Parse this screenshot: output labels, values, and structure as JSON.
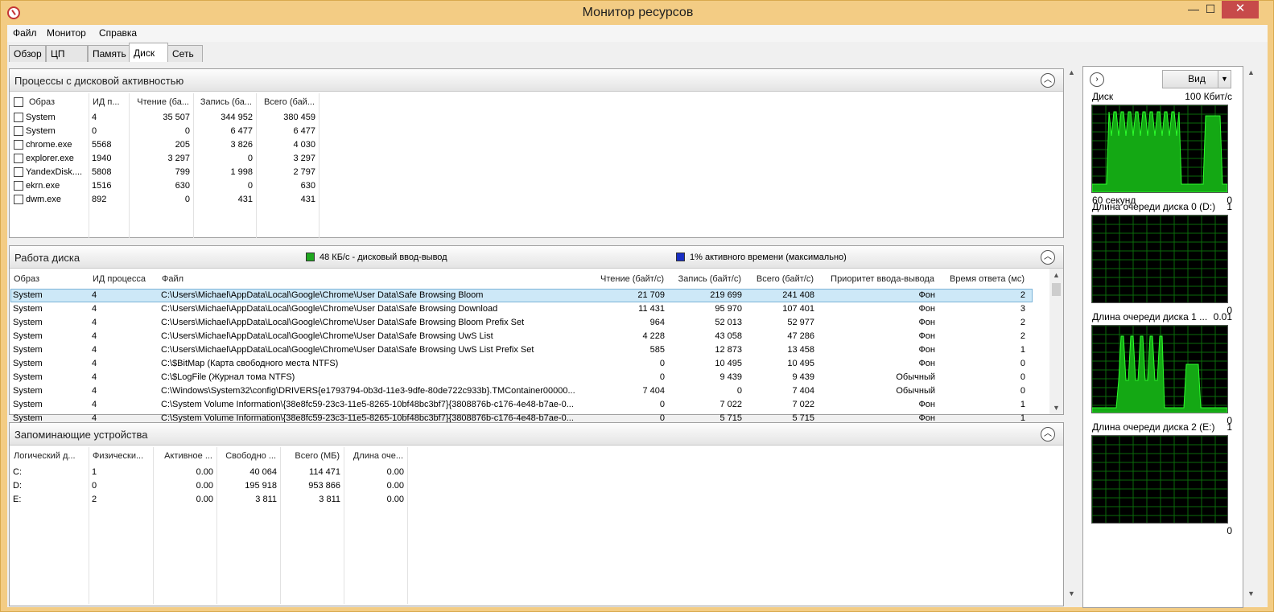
{
  "window": {
    "title": "Монитор ресурсов",
    "minimize": "—",
    "maximize": "☐",
    "close": "✕"
  },
  "menu": [
    "Файл",
    "Монитор",
    "Справка"
  ],
  "tabs": [
    "Обзор",
    "ЦП",
    "Память",
    "Диск",
    "Сеть"
  ],
  "active_tab": "Диск",
  "processes": {
    "title": "Процессы с дисковой активностью",
    "columns": [
      "Образ",
      "ИД п...",
      "Чтение (ба...",
      "Запись (ба...",
      "Всего (бай..."
    ],
    "rows": [
      [
        "System",
        "4",
        "35 507",
        "344 952",
        "380 459"
      ],
      [
        "System",
        "0",
        "0",
        "6 477",
        "6 477"
      ],
      [
        "chrome.exe",
        "5568",
        "205",
        "3 826",
        "4 030"
      ],
      [
        "explorer.exe",
        "1940",
        "3 297",
        "0",
        "3 297"
      ],
      [
        "YandexDisk....",
        "5808",
        "799",
        "1 998",
        "2 797"
      ],
      [
        "ekrn.exe",
        "1516",
        "630",
        "0",
        "630"
      ],
      [
        "dwm.exe",
        "892",
        "0",
        "431",
        "431"
      ]
    ]
  },
  "disk_activity": {
    "title": "Работа диска",
    "legend_io": "48 КБ/с - дисковый ввод-вывод",
    "legend_active": "1% активного времени (максимально)",
    "legend_io_color": "#1fa81f",
    "legend_active_color": "#1a2fc4",
    "columns": [
      "Образ",
      "ИД процесса",
      "Файл",
      "Чтение (байт/с)",
      "Запись (байт/с)",
      "Всего (байт/с)",
      "Приоритет ввода-вывода",
      "Время ответа (мс)"
    ],
    "rows": [
      [
        "System",
        "4",
        "C:\\Users\\Michael\\AppData\\Local\\Google\\Chrome\\User Data\\Safe Browsing Bloom",
        "21 709",
        "219 699",
        "241 408",
        "Фон",
        "2"
      ],
      [
        "System",
        "4",
        "C:\\Users\\Michael\\AppData\\Local\\Google\\Chrome\\User Data\\Safe Browsing Download",
        "11 431",
        "95 970",
        "107 401",
        "Фон",
        "3"
      ],
      [
        "System",
        "4",
        "C:\\Users\\Michael\\AppData\\Local\\Google\\Chrome\\User Data\\Safe Browsing Bloom Prefix Set",
        "964",
        "52 013",
        "52 977",
        "Фон",
        "2"
      ],
      [
        "System",
        "4",
        "C:\\Users\\Michael\\AppData\\Local\\Google\\Chrome\\User Data\\Safe Browsing UwS List",
        "4 228",
        "43 058",
        "47 286",
        "Фон",
        "2"
      ],
      [
        "System",
        "4",
        "C:\\Users\\Michael\\AppData\\Local\\Google\\Chrome\\User Data\\Safe Browsing UwS List Prefix Set",
        "585",
        "12 873",
        "13 458",
        "Фон",
        "1"
      ],
      [
        "System",
        "4",
        "C:\\$BitMap (Карта свободного места NTFS)",
        "0",
        "10 495",
        "10 495",
        "Фон",
        "0"
      ],
      [
        "System",
        "4",
        "C:\\$LogFile (Журнал тома NTFS)",
        "0",
        "9 439",
        "9 439",
        "Обычный",
        "0"
      ],
      [
        "System",
        "4",
        "C:\\Windows\\System32\\config\\DRIVERS{e1793794-0b3d-11e3-9dfe-80de722c933b}.TMContainer00000...",
        "7 404",
        "0",
        "7 404",
        "Обычный",
        "0"
      ],
      [
        "System",
        "4",
        "C:\\System Volume Information\\{38e8fc59-23c3-11e5-8265-10bf48bc3bf7}{3808876b-c176-4e48-b7ae-0...",
        "0",
        "7 022",
        "7 022",
        "Фон",
        "1"
      ],
      [
        "System",
        "4",
        "C:\\System Volume Information\\{38e8fc59-23c3-11e5-8265-10bf48bc3bf7}{3808876b-c176-4e48-b7ae-0...",
        "0",
        "5 715",
        "5 715",
        "Фон",
        "1"
      ]
    ]
  },
  "storage": {
    "title": "Запоминающие устройства",
    "columns": [
      "Логический д...",
      "Физически...",
      "Активное ...",
      "Свободно ...",
      "Всего (МБ)",
      "Длина оче..."
    ],
    "rows": [
      [
        "C:",
        "1",
        "0.00",
        "40 064",
        "114 471",
        "0.00"
      ],
      [
        "D:",
        "0",
        "0.00",
        "195 918",
        "953 866",
        "0.00"
      ],
      [
        "E:",
        "2",
        "0.00",
        "3 811",
        "3 811",
        "0.00"
      ]
    ]
  },
  "side": {
    "view_label": "Вид",
    "graphs": [
      {
        "label": "Диск",
        "max": "100 Кбит/с",
        "bottom_left": "60 секунд",
        "bottom_right": "0"
      },
      {
        "label": "Длина очереди диска 0 (D:)",
        "max": "1",
        "bottom_left": "",
        "bottom_right": "0"
      },
      {
        "label": "Длина очереди диска 1 ...",
        "max": "0.01",
        "bottom_left": "",
        "bottom_right": "0"
      },
      {
        "label": "Длина очереди диска 2 (E:)",
        "max": "1",
        "bottom_left": "",
        "bottom_right": "0"
      }
    ]
  }
}
